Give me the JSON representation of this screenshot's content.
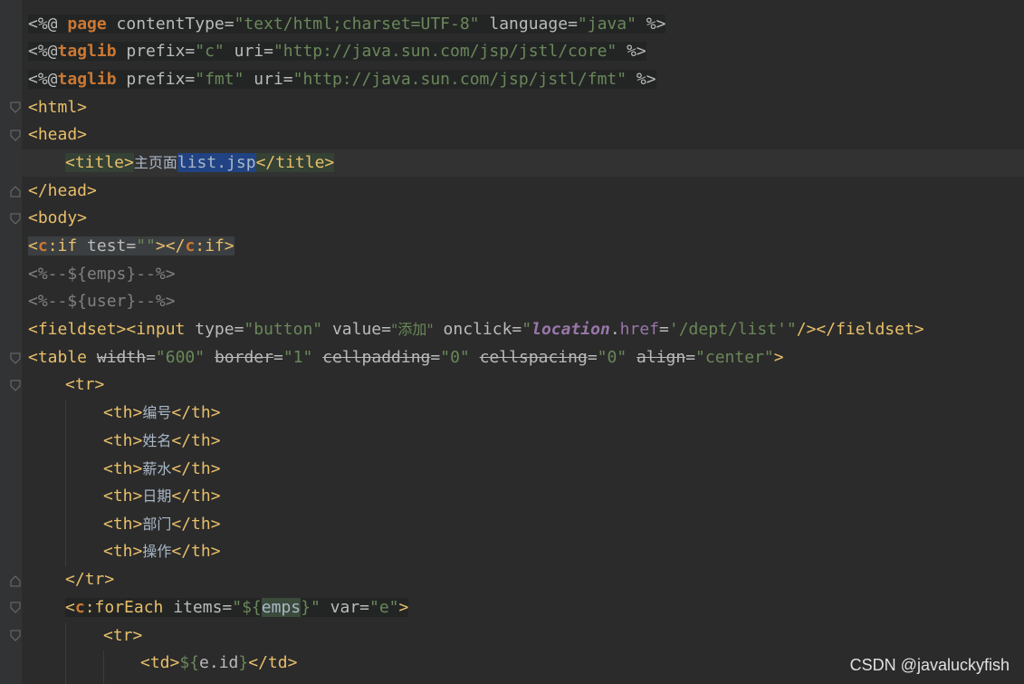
{
  "editor": {
    "lines": {
      "l1": [
        "<%@",
        " page",
        " contentType=",
        "\"text/html;charset=UTF-8\"",
        " language=",
        "\"java\"",
        " %>"
      ],
      "l2": [
        "<%@",
        "taglib",
        " prefix=",
        "\"c\"",
        " uri=",
        "\"http://java.sun.com/jsp/jstl/core\"",
        " %>"
      ],
      "l3": [
        "<%@",
        "taglib",
        " prefix=",
        "\"fmt\"",
        " uri=",
        "\"http://java.sun.com/jsp/jstl/fmt\"",
        " %>"
      ],
      "l4": "<html>",
      "l5": "<head>",
      "l6": [
        "<title>",
        "主页面",
        "list.jsp",
        "</title>"
      ],
      "l7": "</head>",
      "l8": "<body>",
      "l9": [
        "<",
        "c",
        ":if",
        " test=",
        "\"\"",
        "></",
        "c",
        ":if",
        ">"
      ],
      "l10": "<%--${emps}--%>",
      "l11": "<%--${user}--%>",
      "l12": [
        "<fieldset><input",
        " type=",
        "\"button\"",
        " value=",
        "\"添加\"",
        " onclick=",
        "\"",
        "location",
        ".",
        "href",
        "=",
        "'/dept/list'",
        "\"",
        "/></fieldset>"
      ],
      "l13": [
        "<table",
        " ",
        "width",
        "=",
        "\"600\"",
        " ",
        "border",
        "=",
        "\"1\"",
        " ",
        "cellpadding",
        "=",
        "\"0\"",
        " ",
        "cellspacing",
        "=",
        "\"0\"",
        " ",
        "align",
        "=",
        "\"center\"",
        ">"
      ],
      "l14": "<tr>",
      "l15": [
        "<th>",
        "编号",
        "</th>"
      ],
      "l16": [
        "<th>",
        "姓名",
        "</th>"
      ],
      "l17": [
        "<th>",
        "薪水",
        "</th>"
      ],
      "l18": [
        "<th>",
        "日期",
        "</th>"
      ],
      "l19": [
        "<th>",
        "部门",
        "</th>"
      ],
      "l20": [
        "<th>",
        "操作",
        "</th>"
      ],
      "l21": "</tr>",
      "l22": [
        "<",
        "c",
        ":forEach",
        " items=",
        "\"${",
        "emps",
        "}\"",
        " var=",
        "\"e\"",
        ">"
      ],
      "l23": "<tr>",
      "l24": [
        "<td>",
        "${",
        "e.id",
        "}",
        "</td>"
      ]
    }
  },
  "watermark": "CSDN @javaluckyfish"
}
